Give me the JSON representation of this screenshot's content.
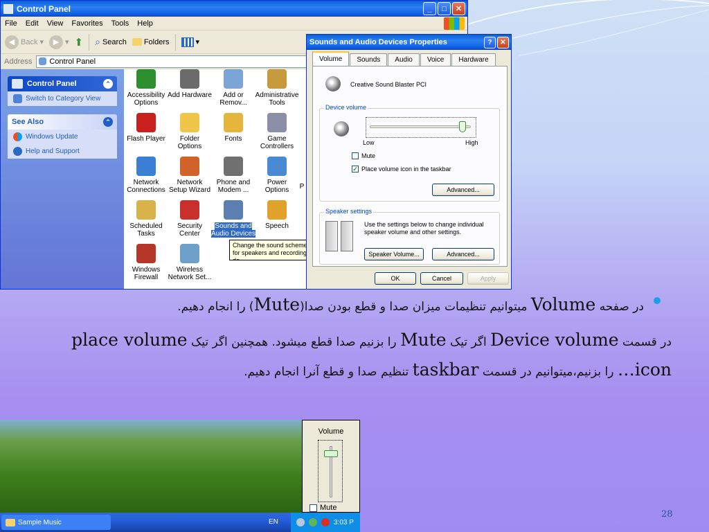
{
  "control_panel": {
    "title": "Control Panel",
    "menu": [
      "File",
      "Edit",
      "View",
      "Favorites",
      "Tools",
      "Help"
    ],
    "toolbar": {
      "back": "Back",
      "search": "Search",
      "folders": "Folders"
    },
    "address_label": "Address",
    "address_value": "Control Panel",
    "side_panel": {
      "title": "Control Panel",
      "switch_link": "Switch to Category View"
    },
    "see_also": {
      "title": "See Also",
      "links": [
        "Windows Update",
        "Help and Support"
      ]
    },
    "icons": [
      {
        "label": "Accessibility Options",
        "color": "#2d8f2d"
      },
      {
        "label": "Add Hardware",
        "color": "#6b6b6b"
      },
      {
        "label": "Add or Remov...",
        "color": "#7aa5d6"
      },
      {
        "label": "Administrative Tools",
        "color": "#c79a3b"
      },
      {
        "label": "Flash Player",
        "color": "#c8201c"
      },
      {
        "label": "Folder Options",
        "color": "#f0c64a"
      },
      {
        "label": "Fonts",
        "color": "#e6b53c"
      },
      {
        "label": "Game Controllers",
        "color": "#8b8fa8"
      },
      {
        "label": "Network Connections",
        "color": "#3b7fd4"
      },
      {
        "label": "Network Setup Wizard",
        "color": "#d0622a"
      },
      {
        "label": "Phone and Modem ...",
        "color": "#707070"
      },
      {
        "label": "Power Options",
        "color": "#4a8ad4"
      },
      {
        "label": "Scheduled Tasks",
        "color": "#d9b34a"
      },
      {
        "label": "Security Center",
        "color": "#c9302c"
      },
      {
        "label": "Sounds and Audio Devices",
        "color": "#5b7fb0"
      },
      {
        "label": "Speech",
        "color": "#e0a22a"
      },
      {
        "label": "Windows Firewall",
        "color": "#b5372a"
      },
      {
        "label": "Wireless Network Set...",
        "color": "#6fa0c8"
      }
    ],
    "partial_icon_label": "P",
    "tooltip": "Change the sound scheme for speakers and recording de"
  },
  "dialog": {
    "title": "Sounds and Audio Devices Properties",
    "tabs": [
      "Volume",
      "Sounds",
      "Audio",
      "Voice",
      "Hardware"
    ],
    "active_tab": "Volume",
    "device_name": "Creative Sound Blaster PCI",
    "device_volume": {
      "title": "Device volume",
      "low_label": "Low",
      "high_label": "High",
      "level": 0.95,
      "mute_label": "Mute",
      "mute_checked": false,
      "place_icon_label": "Place volume icon in the taskbar",
      "place_icon_checked": true,
      "advanced_button": "Advanced..."
    },
    "speaker_settings": {
      "title": "Speaker settings",
      "text": "Use the settings below to change individual speaker volume and other settings.",
      "speaker_volume_button": "Speaker Volume...",
      "advanced_button": "Advanced..."
    },
    "buttons": {
      "ok": "OK",
      "cancel": "Cancel",
      "apply": "Apply"
    }
  },
  "slide": {
    "para1": {
      "t1": "در صفحه",
      "l1": "Volume",
      "t2": "میتوانیم تنظیمات میزان صدا و قطع بودن صدا(",
      "l2": "Mute",
      "t3": ") را انجام دهیم."
    },
    "para2": {
      "t1": "در قسمت",
      "l1": "Device volume",
      "t2": "اگر تیک",
      "l2": "Mute",
      "t3": "را بزنیم صدا قطع میشود. همچنین اگر تیک",
      "l3": "place volume icon…",
      "t4": "را بزنیم،میتوانیم در قسمت",
      "l4": "taskbar",
      "t5": "تنظیم صدا و قطع آنرا انجام دهیم."
    },
    "page_number": "28",
    "bullet_color": "#1ba0e8"
  },
  "taskbar": {
    "item": "Sample Music",
    "lang": "EN",
    "clock": "3:03 P"
  },
  "volume_popup": {
    "title": "Volume",
    "level": 0.9,
    "mute_label": "Mute",
    "mute_checked": false
  }
}
